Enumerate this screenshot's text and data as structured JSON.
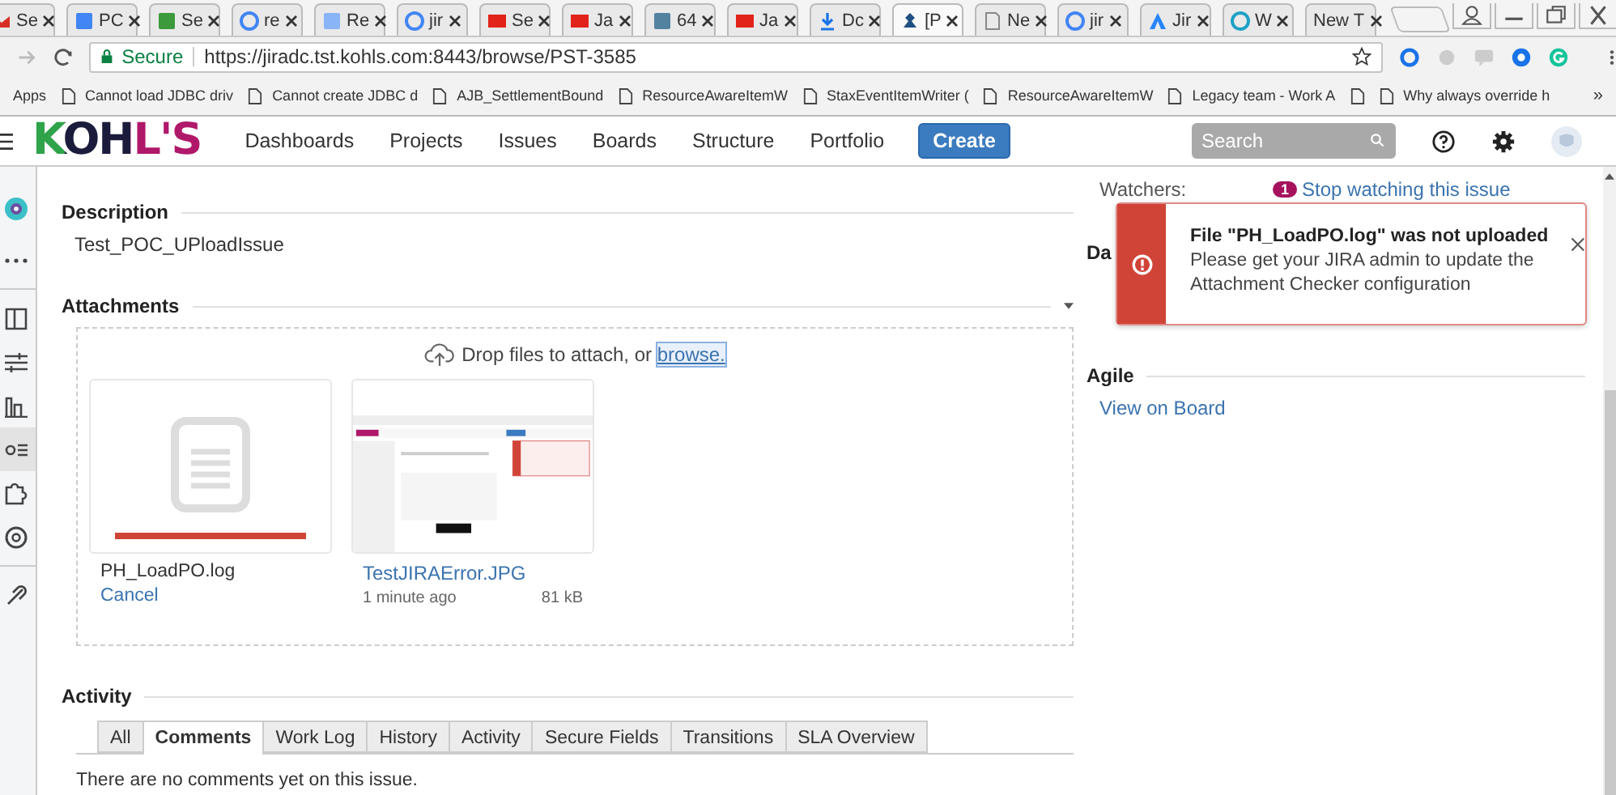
{
  "browser": {
    "tabs": [
      {
        "kind": "mail",
        "label": "Se",
        "selected": false
      },
      {
        "kind": "doc",
        "label": "PC",
        "selected": false
      },
      {
        "kind": "terminal",
        "label": "Se",
        "selected": false
      },
      {
        "kind": "google",
        "label": "re",
        "selected": false
      },
      {
        "label": "Re",
        "selected": false
      },
      {
        "kind": "google",
        "label": "jir",
        "selected": false
      },
      {
        "kind": "oracle",
        "label": "Se",
        "selected": false
      },
      {
        "kind": "oracle",
        "label": "Ja",
        "selected": false
      },
      {
        "kind": "java",
        "label": "64",
        "selected": false
      },
      {
        "kind": "oracle",
        "label": "Ja",
        "selected": false
      },
      {
        "kind": "download",
        "label": "Dc",
        "selected": false
      },
      {
        "kind": "jira",
        "label": "[P",
        "selected": true
      },
      {
        "kind": "page",
        "label": "Ne",
        "selected": false
      },
      {
        "kind": "google",
        "label": "jir",
        "selected": false
      },
      {
        "kind": "atlassian",
        "label": "Jir",
        "selected": false
      },
      {
        "kind": "globe",
        "label": "W",
        "selected": false
      },
      {
        "kind": "blank",
        "label": "New T",
        "selected": false
      }
    ],
    "security": "Secure",
    "url": "https://jiradc.tst.kohls.com:8443/browse/PST-3585",
    "bookmarks": [
      {
        "kind": "apps",
        "label": "Apps"
      },
      {
        "kind": "page",
        "label": "Cannot load JDBC driv"
      },
      {
        "kind": "page",
        "label": "Cannot create JDBC d"
      },
      {
        "kind": "page",
        "label": "AJB_SettlementBound"
      },
      {
        "kind": "page",
        "label": "ResourceAwareItemW"
      },
      {
        "kind": "page",
        "label": "StaxEventItemWriter ("
      },
      {
        "kind": "page",
        "label": "ResourceAwareItemW"
      },
      {
        "kind": "page",
        "label": "Legacy team - Work A"
      },
      {
        "kind": "page"
      },
      {
        "kind": "page",
        "label": "Why always override h"
      }
    ],
    "bookmarks_more": "»"
  },
  "nav": {
    "logo": "KOHL'S",
    "items": [
      "Dashboards",
      "Projects",
      "Issues",
      "Boards",
      "Structure",
      "Portfolio"
    ],
    "create": "Create",
    "search": {
      "placeholder": "Search"
    }
  },
  "sidebar": {
    "items": [
      {
        "kind": "avatar",
        "selected": false
      },
      {
        "kind": "more",
        "selected": false
      },
      {
        "kind": "board",
        "selected": false
      },
      {
        "kind": "filter",
        "selected": false
      },
      {
        "kind": "chart",
        "selected": false
      },
      {
        "kind": "list",
        "selected": true
      },
      {
        "kind": "puzzle",
        "selected": false
      },
      {
        "kind": "gear",
        "selected": false
      },
      {
        "kind": "link",
        "selected": false
      }
    ]
  },
  "issue": {
    "description": {
      "heading": "Description",
      "text": "Test_POC_UPloadIssue"
    },
    "attachments": {
      "heading": "Attachments",
      "drop_text": "Drop files to attach, or ",
      "browse": "browse.",
      "files": [
        {
          "kind": "uploading",
          "name": "PH_LoadPO.log",
          "level": 1,
          "action": "Cancel"
        },
        {
          "name": "TestJIRAError.JPG",
          "age": "1 minute ago",
          "size": "81 kB"
        }
      ]
    },
    "activity": {
      "heading": "Activity",
      "tabs": [
        {
          "label": "All",
          "selected": false
        },
        {
          "label": "Comments",
          "selected": true
        },
        {
          "label": "Work Log",
          "selected": false
        },
        {
          "label": "History",
          "selected": false
        },
        {
          "label": "Activity",
          "selected": false
        },
        {
          "label": "Secure Fields",
          "selected": false
        },
        {
          "label": "Transitions",
          "selected": false
        },
        {
          "label": "SLA Overview",
          "selected": false
        }
      ],
      "empty": "There are no comments yet on this issue."
    }
  },
  "side": {
    "watchers_label": "Watchers:",
    "watchers_count": "1",
    "watch_link": "Stop watching this issue",
    "dates_heading": "Da",
    "agile_heading": "Agile",
    "agile_link": "View on Board"
  },
  "flag": {
    "title": "File \"PH_LoadPO.log\" was not uploaded",
    "body": "Please get your JIRA admin to update the Attachment Checker configuration"
  }
}
